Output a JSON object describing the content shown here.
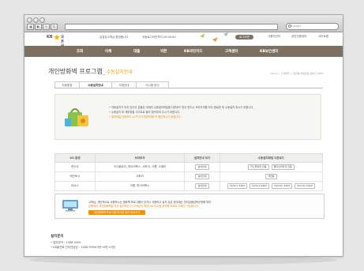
{
  "search": {
    "placeholder": "Google"
  },
  "nav_buttons": [
    "◀",
    "▶",
    "+",
    "↻"
  ],
  "header": {
    "logo_prefix": "KB",
    "logo_name": "오픈뱅킹",
    "welcome": "김경은고객님 환영합니다",
    "session": "자동로그아웃까지 20:00:00",
    "login_button": "로그아웃",
    "links": [
      "사용자관리",
      "공인인증센터",
      "사이트맵"
    ]
  },
  "gnb": [
    "조회",
    "이체",
    "대출",
    "외환",
    "KB국민카드",
    "고객센터",
    "KB보안센터"
  ],
  "page": {
    "title": "개인방화벽 프로그램",
    "subtitle": "_ 수동설치안내",
    "breadcrumb": "Home > 고객센터 > 입력용 비밀번호 생성기 (OPT)"
  },
  "tabs": [
    "자동환경",
    "수동설치안내",
    "삭제안내",
    "이시용 방식"
  ],
  "info": {
    "bullet1": "• 자동설치가 되지 않으신 분들은 아래의 수동설치파일을 다운로드 받아 반드시 브라우저를 모두 종료한 후 수동설치 하시기 바랍니다.",
    "bullet2": "• 수동설치 후 재부팅할 사이트로 돌아 접속하여 주시기 바랍니다.",
    "bullet3": "• 설치파일 다운로드 시 PC의 자장위치를 꼭 확인하시기 바랍니다."
  },
  "table": {
    "headers": [
      "OS 환경",
      "브라우저",
      "설치안내 보기",
      "수동설치파일 다운로드"
    ],
    "rows": [
      {
        "os": "윈도우",
        "browser": "익스플로러, 파이어폭스, 사파리, 크롬, 오페라",
        "guide": "설치안내",
        "downloads": [
          "익스플로러 전용",
          "멀티브라우저 전용"
        ]
      },
      {
        "os": "매킨토시",
        "browser": "사파리",
        "guide": "설치안내",
        "downloads": [
          "맥전용"
        ]
      },
      {
        "os": "리눅스",
        "browser": "크롬, 파이어폭스",
        "guide": "설치안내",
        "downloads": [
          "Fedora 32bit",
          "Fedora 64bit",
          "Ubuntu 32bit",
          "Ubuntu 64bit"
        ]
      }
    ]
  },
  "notice": {
    "line1": "고객님, 개인적으로 사용하시는 방화벽 프로그램이 있거나 사용하고 싶지 않은 경우에는 전자금융감독규정에 따라",
    "line2": "은행에서 개인방화벽을 의무 설치하던 것 고객님의 책임으로 미사용 동의를 하셔야 이체가 가능합니다",
    "button": "개인방화벽 프로그램 미사용 동의 바로가기"
  },
  "contact": {
    "heading": "설치문의",
    "line1": "• 일반문의 : 1588-0000",
    "line2": "• KB출연회 인터넷상담 : 1588-9999(0번→0번→0번)"
  },
  "colors": {
    "gnb": "#7c7161",
    "accent": "#f39200",
    "header_text": "#5c544a"
  }
}
